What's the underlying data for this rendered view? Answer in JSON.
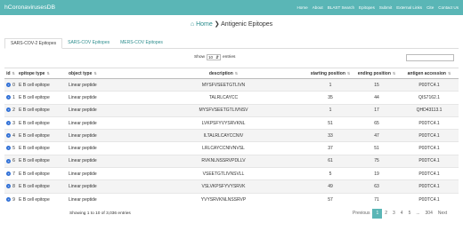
{
  "brand": "hCoronavirusesDB",
  "nav": [
    "Home",
    "About",
    "BLAST Search",
    "Epitopes",
    "Submit",
    "External Links",
    "Cite",
    "Contact Us"
  ],
  "breadcrumb": {
    "home": "Home",
    "sep": "❯",
    "current": "Antigenic Epitopes"
  },
  "tabs": [
    "SARS-COV-2 Epitopes",
    "SARS-COV Epitopes",
    "MERS-COV Epitopes"
  ],
  "length": {
    "prefix": "Show",
    "value": "10",
    "suffix": "entries"
  },
  "columns": [
    "id",
    "epitope type",
    "object type",
    "description",
    "starting position",
    "ending position",
    "antigen accession"
  ],
  "rows": [
    [
      "0",
      "E B cell epitope",
      "Linear peptide",
      "MYSFVSEETGTLIVN",
      "1",
      "15",
      "P0DTC4.1"
    ],
    [
      "1",
      "E B cell epitope",
      "Linear peptide",
      "TALRLCAYCC",
      "35",
      "44",
      "QIS7162.1"
    ],
    [
      "2",
      "E B cell epitope",
      "Linear peptide",
      "MYSFVSEETGTLIVNSV",
      "1",
      "17",
      "QHD43113.1"
    ],
    [
      "3",
      "E B cell epitope",
      "Linear peptide",
      "LVKPSFYVYSRVKNL",
      "51",
      "65",
      "P0DTC4.1"
    ],
    [
      "4",
      "E B cell epitope",
      "Linear peptide",
      "ILTALRLCAYCCNIV",
      "33",
      "47",
      "P0DTC4.1"
    ],
    [
      "5",
      "E B cell epitope",
      "Linear peptide",
      "LRLCAYCCNIVNVSL",
      "37",
      "51",
      "P0DTC4.1"
    ],
    [
      "6",
      "E B cell epitope",
      "Linear peptide",
      "RVKNLNSSRVPDLLV",
      "61",
      "75",
      "P0DTC4.1"
    ],
    [
      "7",
      "E B cell epitope",
      "Linear peptide",
      "VSEETGTLIVNSVLL",
      "5",
      "19",
      "P0DTC4.1"
    ],
    [
      "8",
      "E B cell epitope",
      "Linear peptide",
      "VSLVKPSFYVYSRVK",
      "49",
      "63",
      "P0DTC4.1"
    ],
    [
      "9",
      "E B cell epitope",
      "Linear peptide",
      "YVYSRVKNLNSSRVP",
      "57",
      "71",
      "P0DTC4.1"
    ]
  ],
  "info": "Showing 1 to 10 of 3,036 entries",
  "pagination": [
    "Previous",
    "1",
    "2",
    "3",
    "4",
    "5",
    "...",
    "304",
    "Next"
  ]
}
